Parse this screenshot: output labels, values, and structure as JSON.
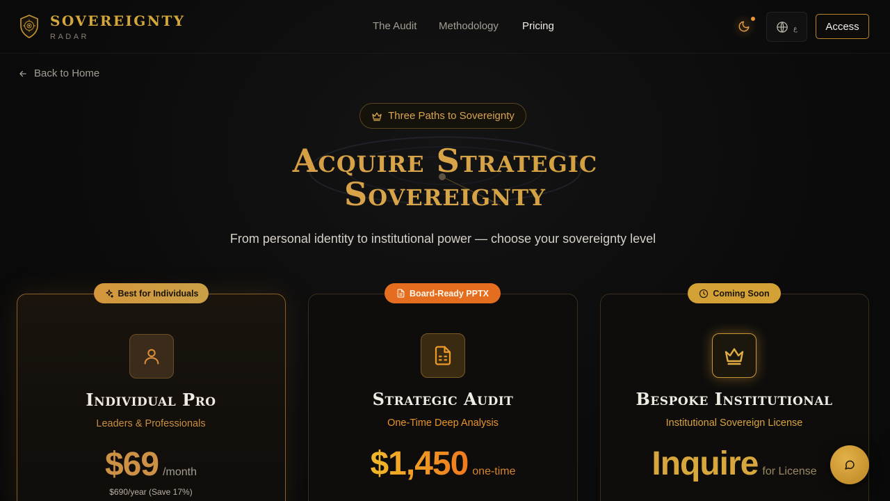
{
  "header": {
    "brand_name": "SOVEREIGNTY",
    "brand_sub": "RADAR",
    "nav": [
      "The Audit",
      "Methodology",
      "Pricing"
    ],
    "active_nav": "Pricing",
    "lang_label": "ع",
    "access_label": "Access"
  },
  "back_label": "Back to Home",
  "hero": {
    "pill": "Three Paths to Sovereignty",
    "title_line1": "Acquire Strategic",
    "title_line2": "Sovereignty",
    "subtitle": "From personal identity to institutional power — choose your sovereignty level"
  },
  "cards": [
    {
      "badge": "Best for Individuals",
      "badge_icon": "sparkles-icon",
      "icon": "user-icon",
      "name": "Individual Pro",
      "subtitle": "Leaders & Professionals",
      "price": "$69",
      "unit": "/month",
      "note": "$690/year (Save 17%)"
    },
    {
      "badge": "Board-Ready PPTX",
      "badge_icon": "file-icon",
      "icon": "document-icon",
      "name": "Strategic Audit",
      "subtitle": "One-Time Deep Analysis",
      "price": "$1,450",
      "unit": "one-time"
    },
    {
      "badge": "Coming Soon",
      "badge_icon": "clock-icon",
      "icon": "crown-icon",
      "name": "Bespoke Institutional",
      "subtitle": "Institutional Sovereign License",
      "price": "Inquire",
      "unit": "for License"
    }
  ],
  "colors": {
    "gold": "#d4a73a",
    "orange": "#e8721f",
    "background": "#0b0b0b"
  }
}
